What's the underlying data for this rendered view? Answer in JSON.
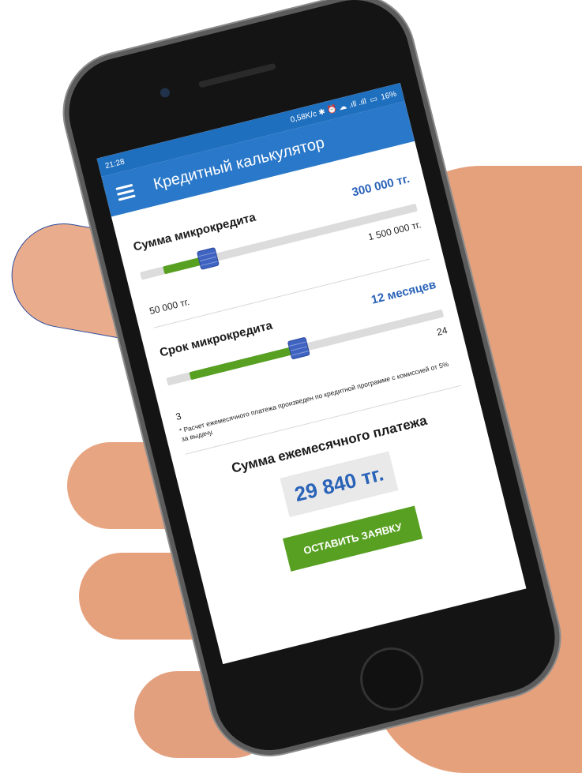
{
  "status_bar": {
    "time": "21:28",
    "indicators": "0,58K/c ✱ ⏰ ☁ .ıll .ıll",
    "battery": "16%"
  },
  "app_bar": {
    "menu_icon": "hamburger-icon",
    "title": "Кредитный калькулятор"
  },
  "loan_amount": {
    "label": "Сумма микрокредита",
    "value": "300 000 тг.",
    "min_label": "50 000 тг.",
    "max_label": "1 500 000 тг.",
    "min": 50000,
    "max": 1500000,
    "current": 300000
  },
  "loan_term": {
    "label": "Срок микрокредита",
    "value": "12 месяцев",
    "min_label": "3",
    "max_label": "24",
    "min": 3,
    "max": 24,
    "current": 12
  },
  "note": "* Расчет ежемесячного платежа произведен по кредитной программе с комиссией от 5% за выдачу.",
  "payment": {
    "title": "Сумма ежемесячного платежа",
    "amount": "29 840 тг."
  },
  "apply_button": "ОСТАВИТЬ ЗАЯВКУ",
  "colors": {
    "primary": "#2a78c9",
    "accent_green": "#58a022",
    "value_blue": "#2a63b8"
  }
}
